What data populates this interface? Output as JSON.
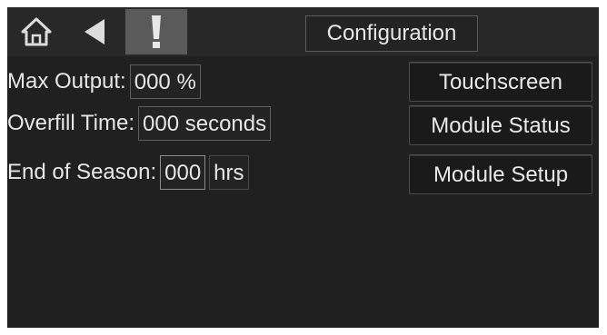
{
  "topbar": {
    "title": "Configuration",
    "icons": [
      "home-icon",
      "back-arrow-icon",
      "alert-icon"
    ]
  },
  "settings": [
    {
      "label": "Max Output:",
      "value": "000 %",
      "unit": ""
    },
    {
      "label": "Overfill Time:",
      "value": "000 seconds",
      "unit": ""
    },
    {
      "label": "End of Season:",
      "value": "000",
      "unit": "hrs"
    }
  ],
  "menu": {
    "touchscreen": "Touchscreen",
    "module_status": "Module Status",
    "module_setup": "Module Setup"
  },
  "colors": {
    "background": "#202020",
    "text": "#e6e6e6",
    "alert_highlight": "#5a5a5a"
  }
}
